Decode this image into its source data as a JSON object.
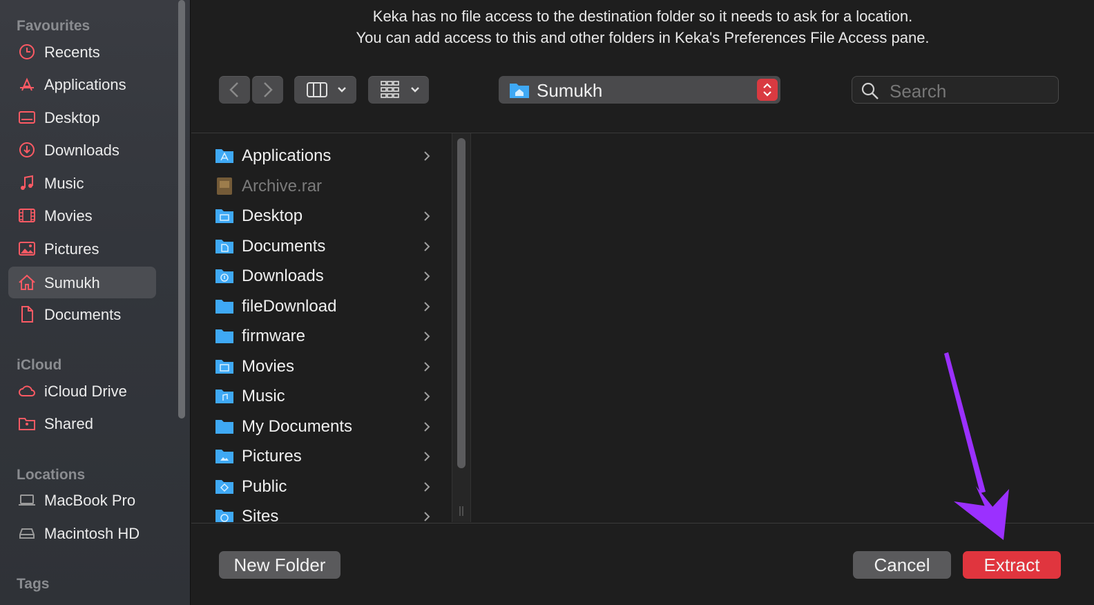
{
  "sidebar": {
    "favourites_heading": "Favourites",
    "favourites": [
      {
        "label": "Recents",
        "icon": "clock-icon"
      },
      {
        "label": "Applications",
        "icon": "applications-icon"
      },
      {
        "label": "Desktop",
        "icon": "desktop-icon"
      },
      {
        "label": "Downloads",
        "icon": "downloads-icon"
      },
      {
        "label": "Music",
        "icon": "music-note-icon"
      },
      {
        "label": "Movies",
        "icon": "film-icon"
      },
      {
        "label": "Pictures",
        "icon": "photo-icon"
      },
      {
        "label": "Sumukh",
        "icon": "home-icon",
        "selected": true
      },
      {
        "label": "Documents",
        "icon": "document-icon"
      }
    ],
    "icloud_heading": "iCloud",
    "icloud": [
      {
        "label": "iCloud Drive",
        "icon": "cloud-icon"
      },
      {
        "label": "Shared",
        "icon": "shared-folder-icon"
      }
    ],
    "locations_heading": "Locations",
    "locations": [
      {
        "label": "MacBook Pro",
        "icon": "laptop-icon"
      },
      {
        "label": "Macintosh HD",
        "icon": "hard-drive-icon"
      }
    ],
    "tags_heading": "Tags"
  },
  "message": {
    "line1": "Keka has no file access to the destination folder so it needs to ask for a location.",
    "line2": "You can add access to this and other folders in Keka's Preferences File Access pane."
  },
  "toolbar": {
    "location": "Sumukh",
    "search_placeholder": "Search"
  },
  "files": [
    {
      "label": "Applications",
      "kind": "folder",
      "has_children": true
    },
    {
      "label": "Archive.rar",
      "kind": "archive",
      "has_children": false,
      "disabled": true
    },
    {
      "label": "Desktop",
      "kind": "folder",
      "has_children": true
    },
    {
      "label": "Documents",
      "kind": "folder",
      "has_children": true
    },
    {
      "label": "Downloads",
      "kind": "folder",
      "has_children": true
    },
    {
      "label": "fileDownload",
      "kind": "folder",
      "has_children": true
    },
    {
      "label": "firmware",
      "kind": "folder",
      "has_children": true
    },
    {
      "label": "Movies",
      "kind": "folder",
      "has_children": true
    },
    {
      "label": "Music",
      "kind": "folder",
      "has_children": true
    },
    {
      "label": "My Documents",
      "kind": "folder",
      "has_children": true
    },
    {
      "label": "Pictures",
      "kind": "folder",
      "has_children": true
    },
    {
      "label": "Public",
      "kind": "folder",
      "has_children": true
    },
    {
      "label": "Sites",
      "kind": "folder",
      "has_children": true
    }
  ],
  "buttons": {
    "new_folder": "New Folder",
    "cancel": "Cancel",
    "extract": "Extract"
  },
  "colors": {
    "accent_red": "#e0353e",
    "sidebar_icon": "#ff5a64",
    "folder_blue": "#3fa9f5",
    "annotation_arrow": "#9b30ff"
  }
}
